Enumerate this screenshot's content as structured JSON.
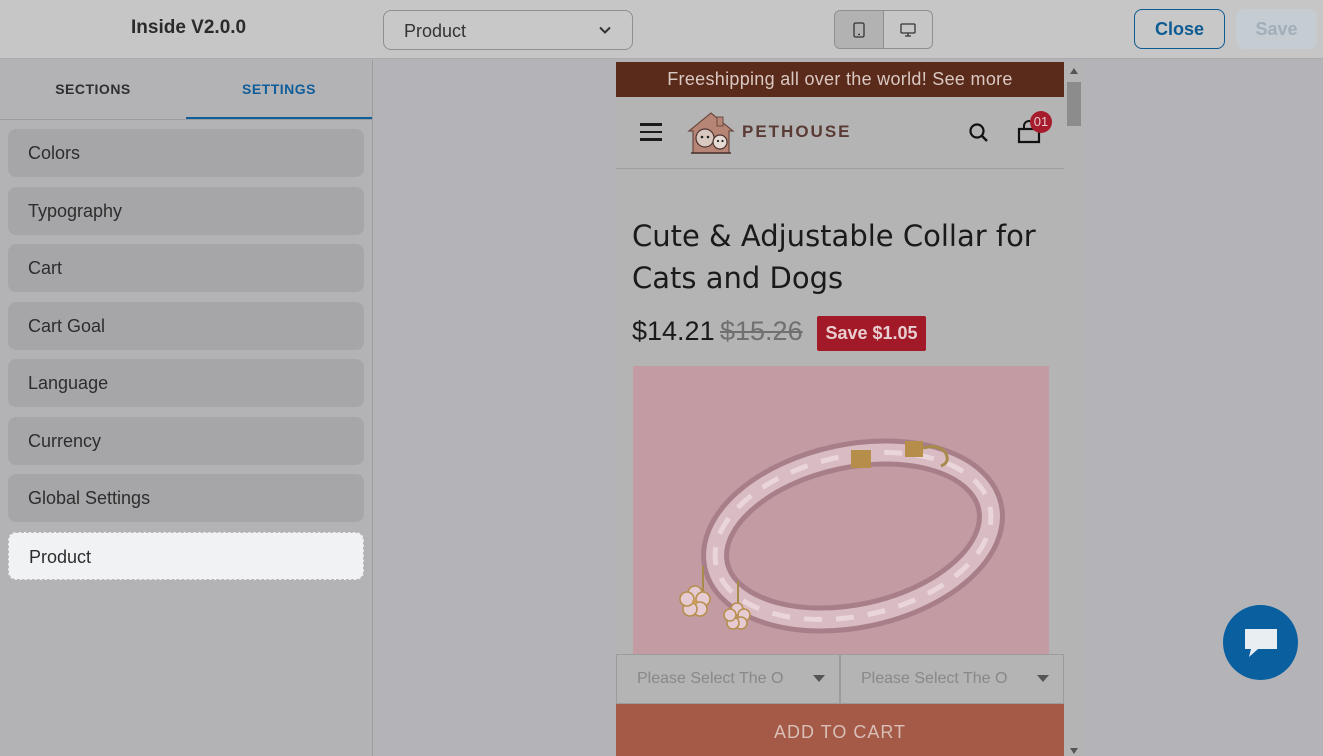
{
  "topbar": {
    "app_title": "Inside V2.0.0",
    "page_select": "Product",
    "view_modes": [
      "mobile-icon",
      "desktop-icon"
    ],
    "close_label": "Close",
    "save_label": "Save"
  },
  "sidebar": {
    "tabs": [
      {
        "label": "SECTIONS",
        "active": false
      },
      {
        "label": "SETTINGS",
        "active": true
      }
    ],
    "items": [
      {
        "label": "Colors"
      },
      {
        "label": "Typography"
      },
      {
        "label": "Cart"
      },
      {
        "label": "Cart Goal"
      },
      {
        "label": "Language"
      },
      {
        "label": "Currency"
      },
      {
        "label": "Global Settings"
      },
      {
        "label": "Product",
        "selected": true
      }
    ]
  },
  "preview": {
    "announcement": "Freeshipping all over the world! See more",
    "brand": "PETHOUSE",
    "cart_count": "01",
    "product_title": "Cute & Adjustable Collar for Cats and Dogs",
    "price": "$14.21",
    "compare_price": "$15.26",
    "save_badge": "Save $1.05",
    "variant_1_placeholder": "Please Select The O",
    "variant_2_placeholder": "Please Select The O",
    "add_to_cart": "ADD TO CART"
  },
  "colors": {
    "accent": "#0f5e99",
    "announcement_bg": "#5a2a1b",
    "save_badge_bg": "#a21a27",
    "add_to_cart_bg": "#a45a47",
    "chat_bg": "#0a5f9f"
  }
}
